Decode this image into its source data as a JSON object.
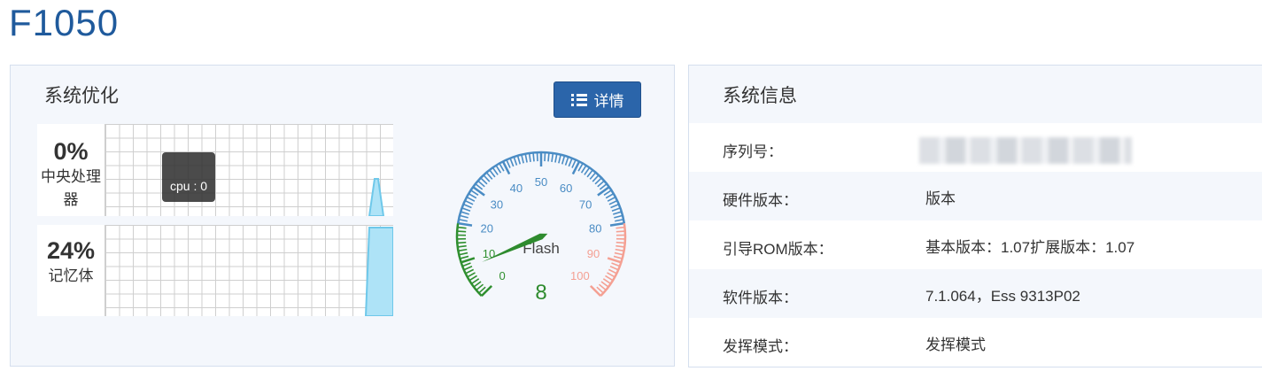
{
  "page": {
    "title": "F1050"
  },
  "optimization": {
    "heading": "系统优化",
    "detail_button": "详情",
    "cpu": {
      "percent": "0%",
      "label": "中央处理器",
      "value": 0
    },
    "memory": {
      "percent": "24%",
      "label": "记忆体",
      "value": 24
    },
    "tooltip": "cpu : 0",
    "colors": {
      "chart_line": "#6ec8ea",
      "chart_fill": "#aee3f7"
    }
  },
  "gauge": {
    "name": "Flash",
    "value": 8,
    "value_label": "8",
    "ticks": [
      "0",
      "10",
      "20",
      "30",
      "40",
      "50",
      "60",
      "70",
      "80",
      "90",
      "100"
    ],
    "colors": {
      "low": "#2f8f2f",
      "mid": "#4a8cc4",
      "high": "#f4a093",
      "needle": "#2e8b2e"
    }
  },
  "info": {
    "heading": "系统信息",
    "rows": [
      {
        "key": "序列号：",
        "value": ""
      },
      {
        "key": "硬件版本：",
        "value": "版本"
      },
      {
        "key": "引导ROM版本：",
        "value": "基本版本：1.07扩展版本：1.07"
      },
      {
        "key": "软件版本：",
        "value": "7.1.064，Ess 9313P02"
      },
      {
        "key": "发挥模式：",
        "value": "发挥模式"
      }
    ]
  }
}
